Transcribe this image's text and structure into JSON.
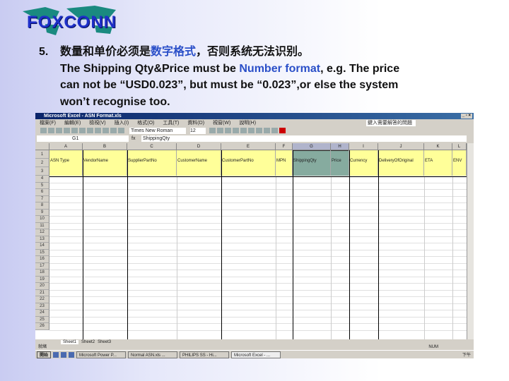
{
  "logo": {
    "text": "FOXCONN"
  },
  "note": {
    "number": "5.",
    "zh_pre": "数量和单价必须是",
    "zh_hl": "数字格式",
    "zh_post": "，否则系统无法识别。",
    "line1_pre": "The Shipping Qty&Price must be ",
    "line1_hl": "Number format",
    "line1_post": ", e.g.  The price",
    "line2": "can not  be “USD0.023”, but must be “0.023”,or  else the system",
    "line3": "won’t  recognise too."
  },
  "excel": {
    "title": "Microsoft Excel - ASN Format.xls",
    "window_buttons": "_ ▫ ×",
    "menu": [
      "檔案(F)",
      "編輯(E)",
      "檢視(V)",
      "插入(I)",
      "格式(O)",
      "工具(T)",
      "資料(D)",
      "視窗(W)",
      "說明(H)"
    ],
    "ask_box": "鍵入需要解答的問題",
    "font": "Times New Roman",
    "font_size": "12",
    "name_box": "G1",
    "fx": "fx",
    "formula_value": "ShippingQty",
    "columns": [
      "A",
      "B",
      "C",
      "D",
      "E",
      "F",
      "G",
      "H",
      "I",
      "J",
      "K",
      "L"
    ],
    "headers": [
      "ASN Type",
      "VendorName",
      "SupplierPartNo",
      "CustomerName",
      "CustomerPartNo",
      "MPN",
      "ShippingQty",
      "Price",
      "Currency",
      "DeliveryOfOriginal",
      "ETA",
      "ENV"
    ],
    "rows": [
      "1",
      "2",
      "3",
      "4",
      "5",
      "6",
      "7",
      "8",
      "9",
      "10",
      "11",
      "12",
      "13",
      "14",
      "15",
      "16",
      "17",
      "18",
      "19",
      "20",
      "21",
      "22",
      "23",
      "24",
      "25",
      "26"
    ],
    "sheet_tabs": [
      "Sheet1",
      "Sheet2",
      "Sheet3"
    ],
    "status_left": "就緒",
    "status_mode": "NUM",
    "taskbar": {
      "start": "開始",
      "tasks": [
        "Microsoft Power P...",
        "Normal ASN.xls ...",
        "PHILIPS SS - Hi...",
        "Microsoft Excel - ..."
      ],
      "clock": "下午"
    }
  }
}
